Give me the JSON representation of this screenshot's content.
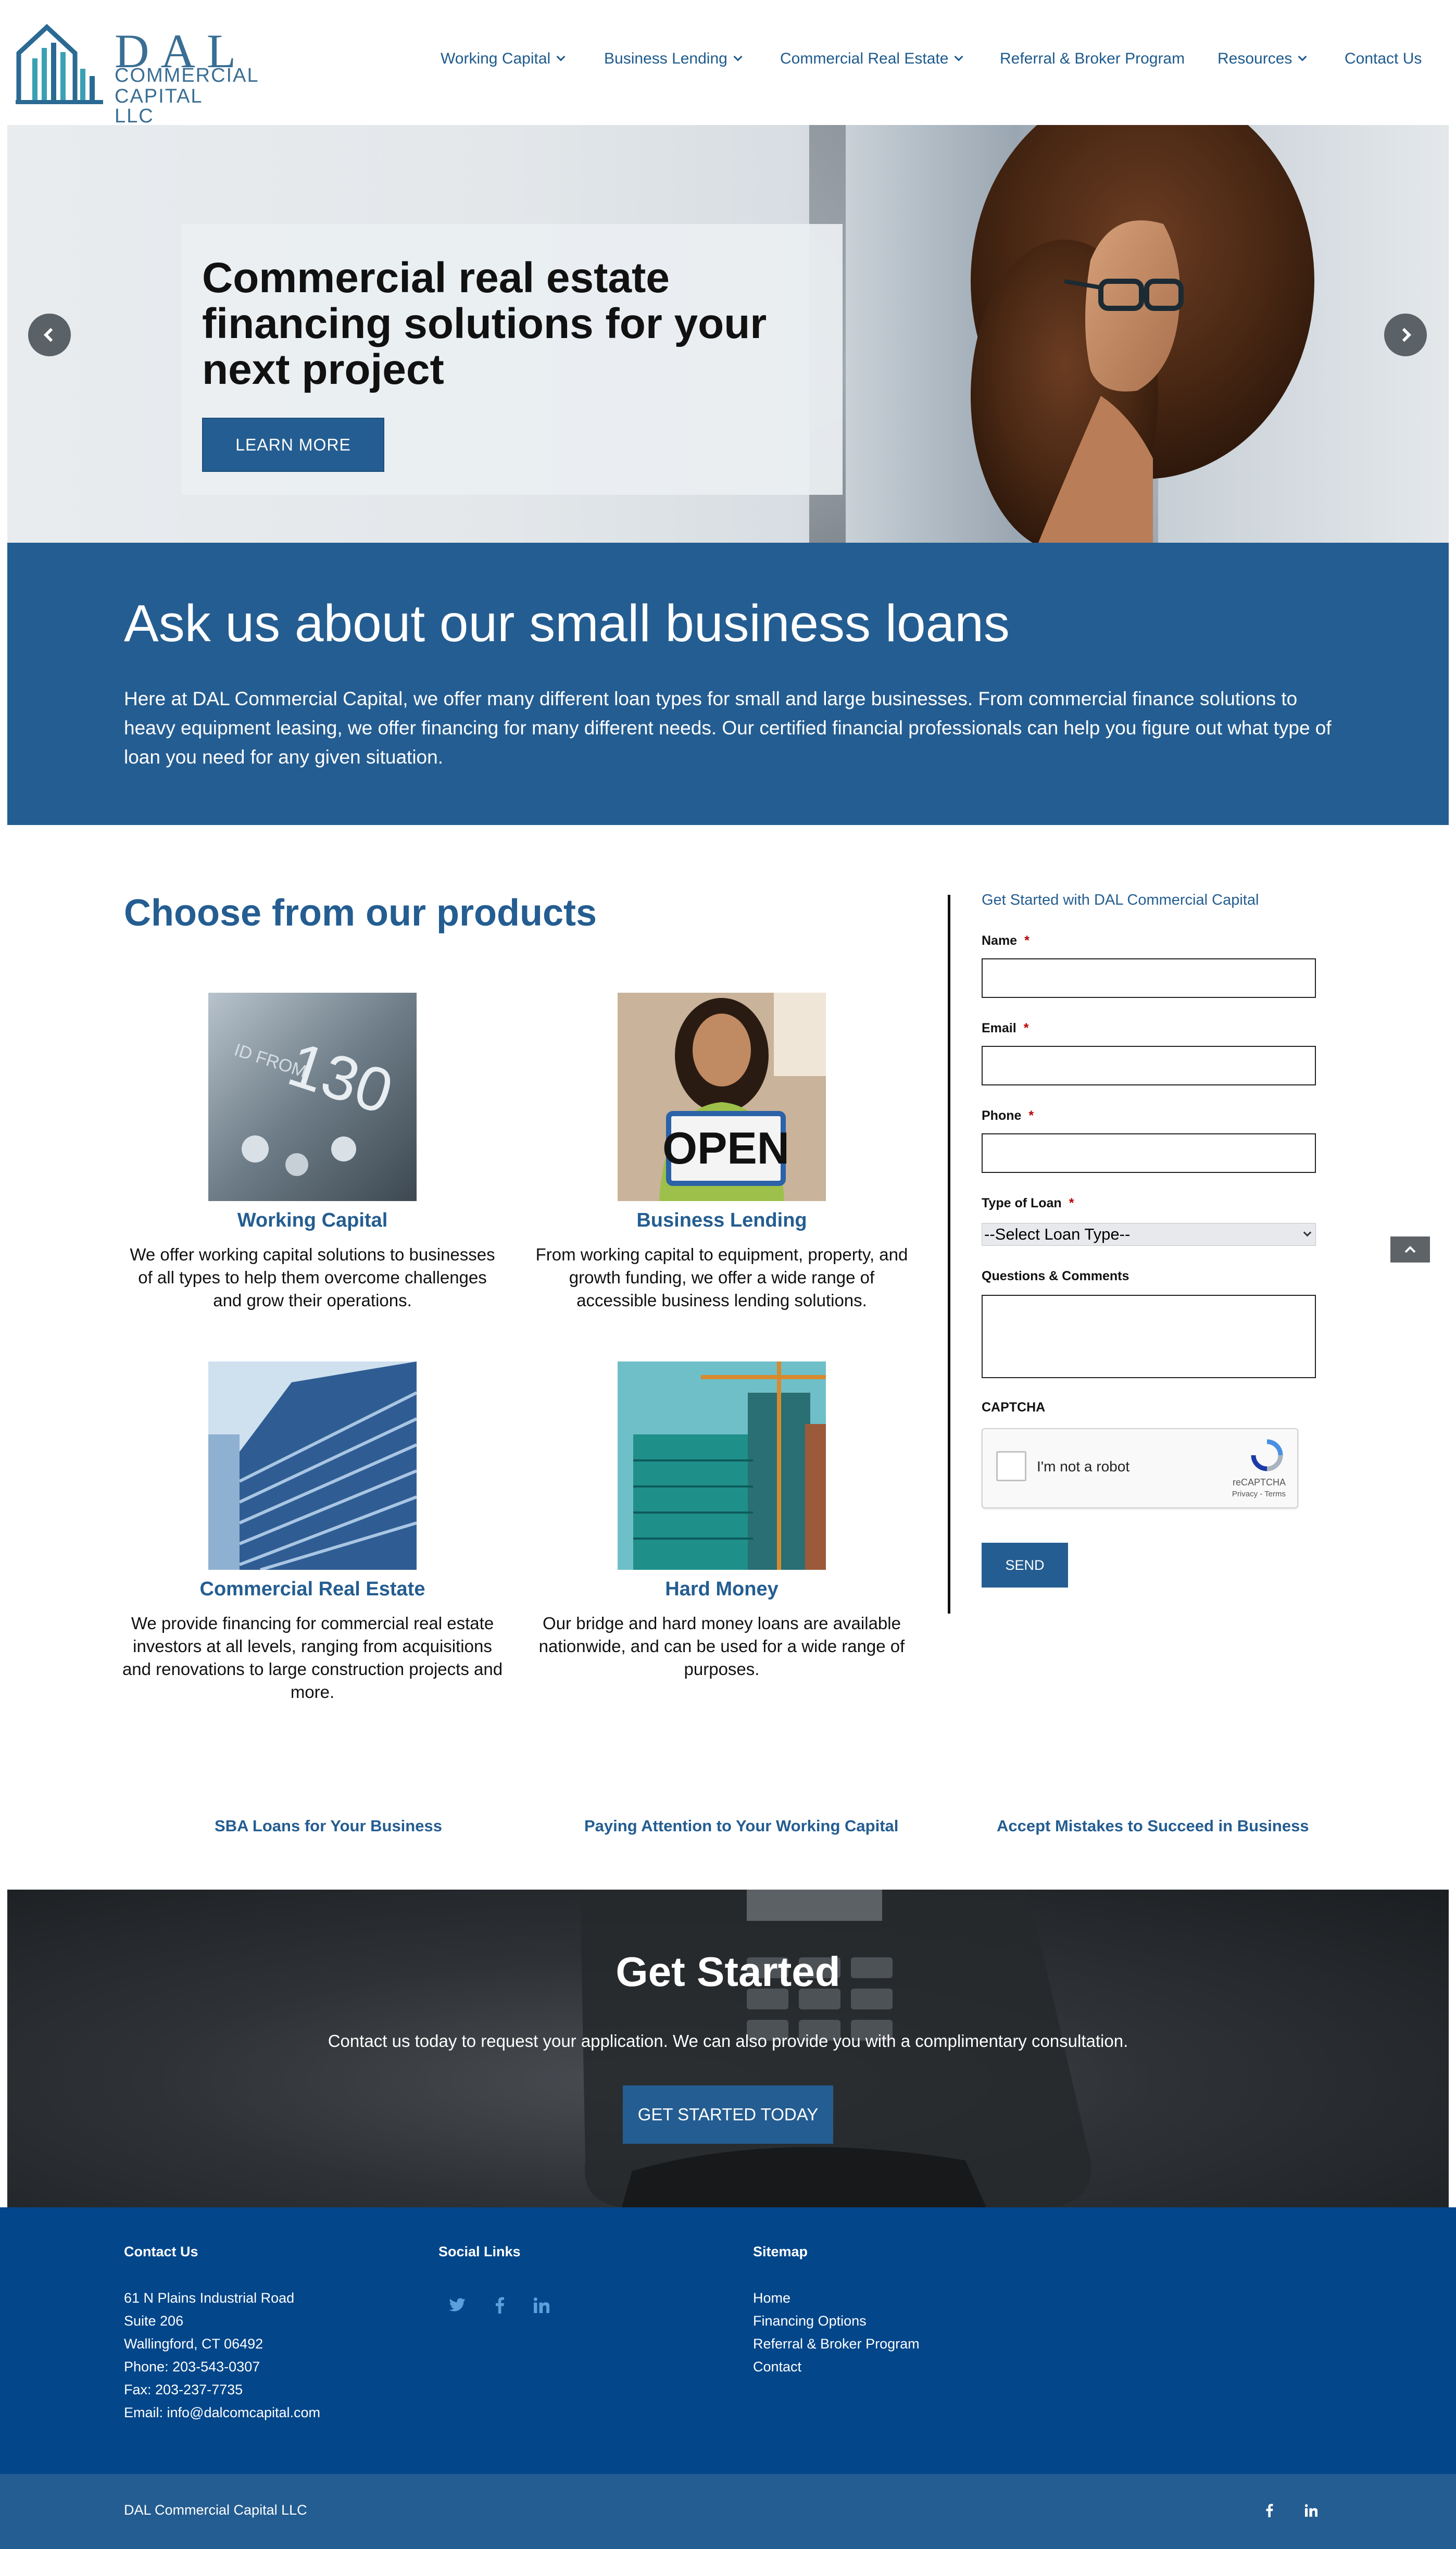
{
  "brand": {
    "logo_main": "DAL",
    "logo_line1": "COMMERCIAL",
    "logo_line2": "CAPITAL LLC"
  },
  "nav": {
    "items": [
      {
        "label": "Working Capital",
        "dropdown": true
      },
      {
        "label": "Business Lending",
        "dropdown": true
      },
      {
        "label": "Commercial Real Estate",
        "dropdown": true
      },
      {
        "label": "Referral & Broker Program",
        "dropdown": false
      },
      {
        "label": "Resources",
        "dropdown": true
      },
      {
        "label": "Contact Us",
        "dropdown": false
      }
    ]
  },
  "hero": {
    "title": "Commercial real estate financing solutions for your next project",
    "button": "LEARN MORE",
    "prev_icon": "chevron-left-icon",
    "next_icon": "chevron-right-icon"
  },
  "ask": {
    "title": "Ask us about our small business loans",
    "text": "Here at DAL Commercial Capital, we offer many different loan types for small and large businesses. From commercial finance solutions to heavy equipment leasing, we offer financing for many different needs. Our certified financial professionals can help you figure out what type of loan you need for any given situation."
  },
  "products": {
    "title": "Choose from our products",
    "items": [
      {
        "name": "Working Capital",
        "desc": "We offer working capital solutions to businesses of all types to help them overcome challenges and grow their operations."
      },
      {
        "name": "Business Lending",
        "desc": "From working capital to equipment, property, and growth funding, we offer a wide range of accessible business lending solutions."
      },
      {
        "name": "Commercial Real Estate",
        "desc": "We provide financing for commercial real estate investors at all levels, ranging from acquisitions and renovations to large construction projects and more."
      },
      {
        "name": "Hard Money",
        "desc": "Our bridge and hard money loans are available nationwide, and can be used for a wide range of purposes."
      }
    ],
    "image_text": {
      "card": "130",
      "card_small": "ID FROM",
      "sign": "OPEN"
    }
  },
  "form": {
    "heading": "Get Started with DAL Commercial Capital",
    "name_label": "Name",
    "email_label": "Email",
    "phone_label": "Phone",
    "loan_type_label": "Type of Loan",
    "loan_type_selected": "--Select Loan Type--",
    "comments_label": "Questions & Comments",
    "captcha_label": "CAPTCHA",
    "required_mark": "*",
    "recaptcha_text": "I'm not a robot",
    "recaptcha_brand": "reCAPTCHA",
    "recaptcha_terms": "Privacy - Terms",
    "send": "SEND"
  },
  "blog_links": [
    "SBA Loans for Your Business",
    "Paying Attention to Your Working Capital",
    "Accept Mistakes to Succeed in Business"
  ],
  "get_started": {
    "title": "Get Started",
    "text": "Contact us today to request your application. We can also provide you with a complimentary consultation.",
    "button": "GET STARTED TODAY"
  },
  "footer": {
    "contact_title": "Contact Us",
    "contact_lines": [
      "61 N Plains Industrial Road",
      "Suite 206",
      "Wallingford, CT 06492",
      "Phone: 203-543-0307",
      "Fax: 203-237-7735",
      "Email: info@dalcomcapital.com"
    ],
    "social_title": "Social Links",
    "social_icons": [
      "twitter-icon",
      "facebook-icon",
      "linkedin-icon"
    ],
    "sitemap_title": "Sitemap",
    "sitemap_links": [
      "Home",
      "Financing Options",
      "Referral & Broker Program",
      "Contact"
    ],
    "copyright": "DAL Commercial Capital LLC",
    "bottom_icons": [
      "facebook-icon",
      "linkedin-icon"
    ]
  },
  "colors": {
    "brand_blue": "#245d91",
    "footer_blue": "#03468a",
    "nav_text": "#1e5a8c"
  }
}
